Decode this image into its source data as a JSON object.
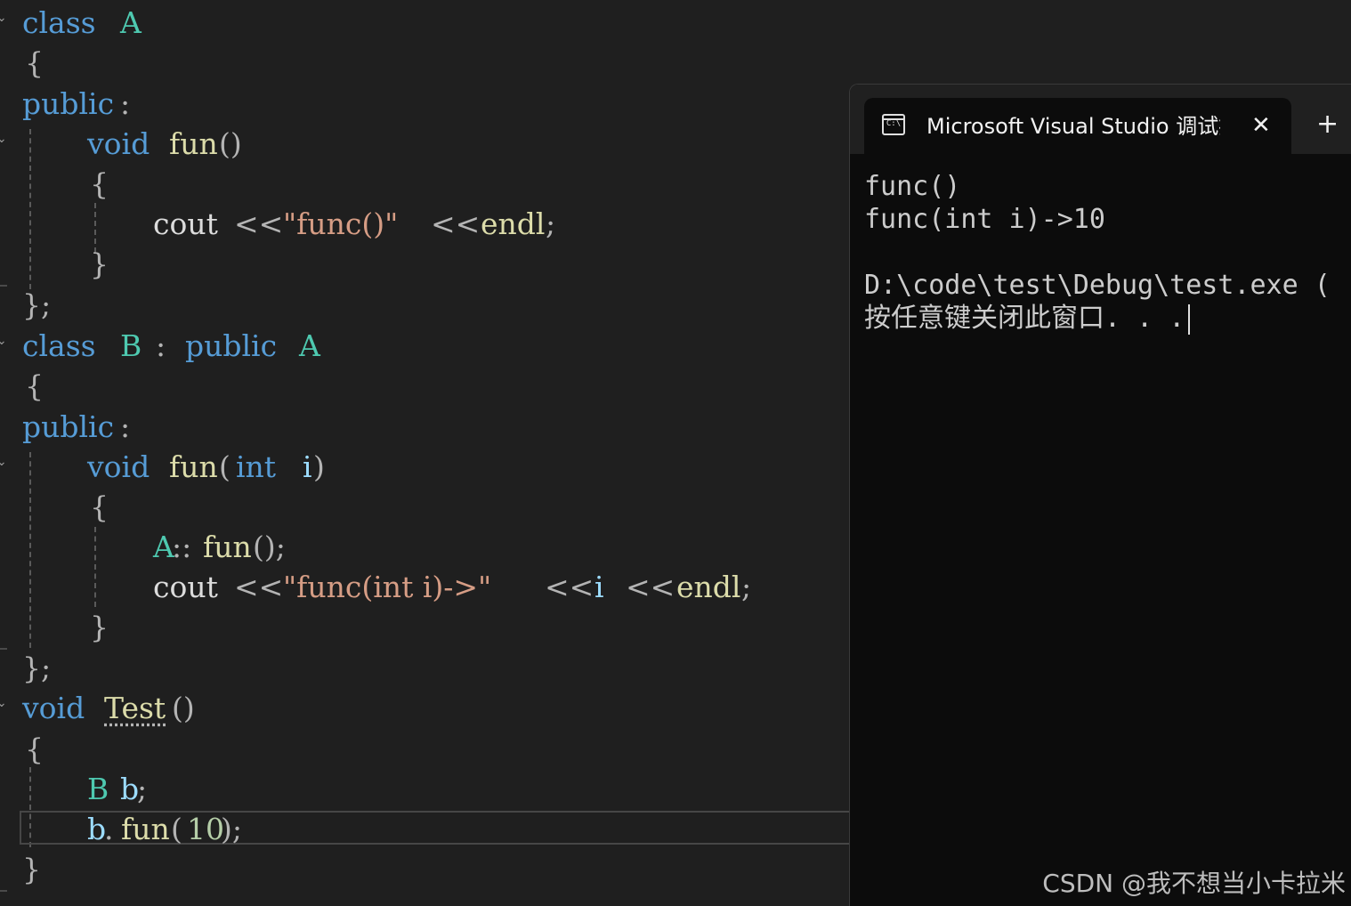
{
  "editor": {
    "lines": {
      "l1": {
        "kw": "class",
        "type": "A"
      },
      "l2": {
        "brace": "{"
      },
      "l3": {
        "kw": "public",
        "colon": ":"
      },
      "l4": {
        "kw": "void",
        "fn": "fun",
        "paren": "()"
      },
      "l5": {
        "brace": "{"
      },
      "l6": {
        "plain": "cout",
        "op1": "<<",
        "str": "\"func()\"",
        "op2": "<<",
        "fn": "endl",
        "semi": ";"
      },
      "l7": {
        "brace": "}"
      },
      "l8": {
        "brace": "};"
      },
      "l9": {
        "kw": "class",
        "type": "B",
        "colon": ":",
        "kw2": "public",
        "type2": "A"
      },
      "l10": {
        "brace": "{"
      },
      "l11": {
        "kw": "public",
        "colon": ":"
      },
      "l12": {
        "kw": "void",
        "fn": "fun",
        "open": "(",
        "kw2": "int",
        "param": "i",
        "close": ")"
      },
      "l13": {
        "brace": "{"
      },
      "l14": {
        "type": "A",
        "scope": "::",
        "fn": "fun",
        "rest": "();"
      },
      "l15": {
        "plain": "cout",
        "op1": "<<",
        "str": "\"func(int i)->\"",
        "op2": "<<",
        "var": "i",
        "op3": "<<",
        "fn": "endl",
        "semi": ";"
      },
      "l16": {
        "brace": "}"
      },
      "l17": {
        "brace": "};"
      },
      "l18": {
        "kw": "void",
        "fn": "Test",
        "paren": "()"
      },
      "l19": {
        "brace": "{"
      },
      "l20": {
        "type": "B",
        "var": "b",
        "semi": ";"
      },
      "l21": {
        "var": "b",
        "dot": ".",
        "fn": "fun",
        "open": "(",
        "num": "10",
        "rest": ");"
      },
      "l22": {
        "brace": "}"
      }
    }
  },
  "terminal": {
    "tab_title": "Microsoft Visual Studio 调试控制台",
    "icon_label": "C:\\",
    "close_glyph": "✕",
    "new_tab_glyph": "+",
    "output": [
      "func()",
      "func(int i)->10",
      "",
      "D:\\code\\test\\Debug\\test.exe (",
      "按任意键关闭此窗口. . ."
    ]
  },
  "watermark": "CSDN @我不想当小卡拉米",
  "colors": {
    "keyword": "#569cd6",
    "type": "#4ec9b0",
    "function": "#dcdcaa",
    "string": "#d69d85",
    "number": "#b5cea8",
    "background": "#1f1f1f",
    "terminal_bg": "#0c0c0c"
  }
}
